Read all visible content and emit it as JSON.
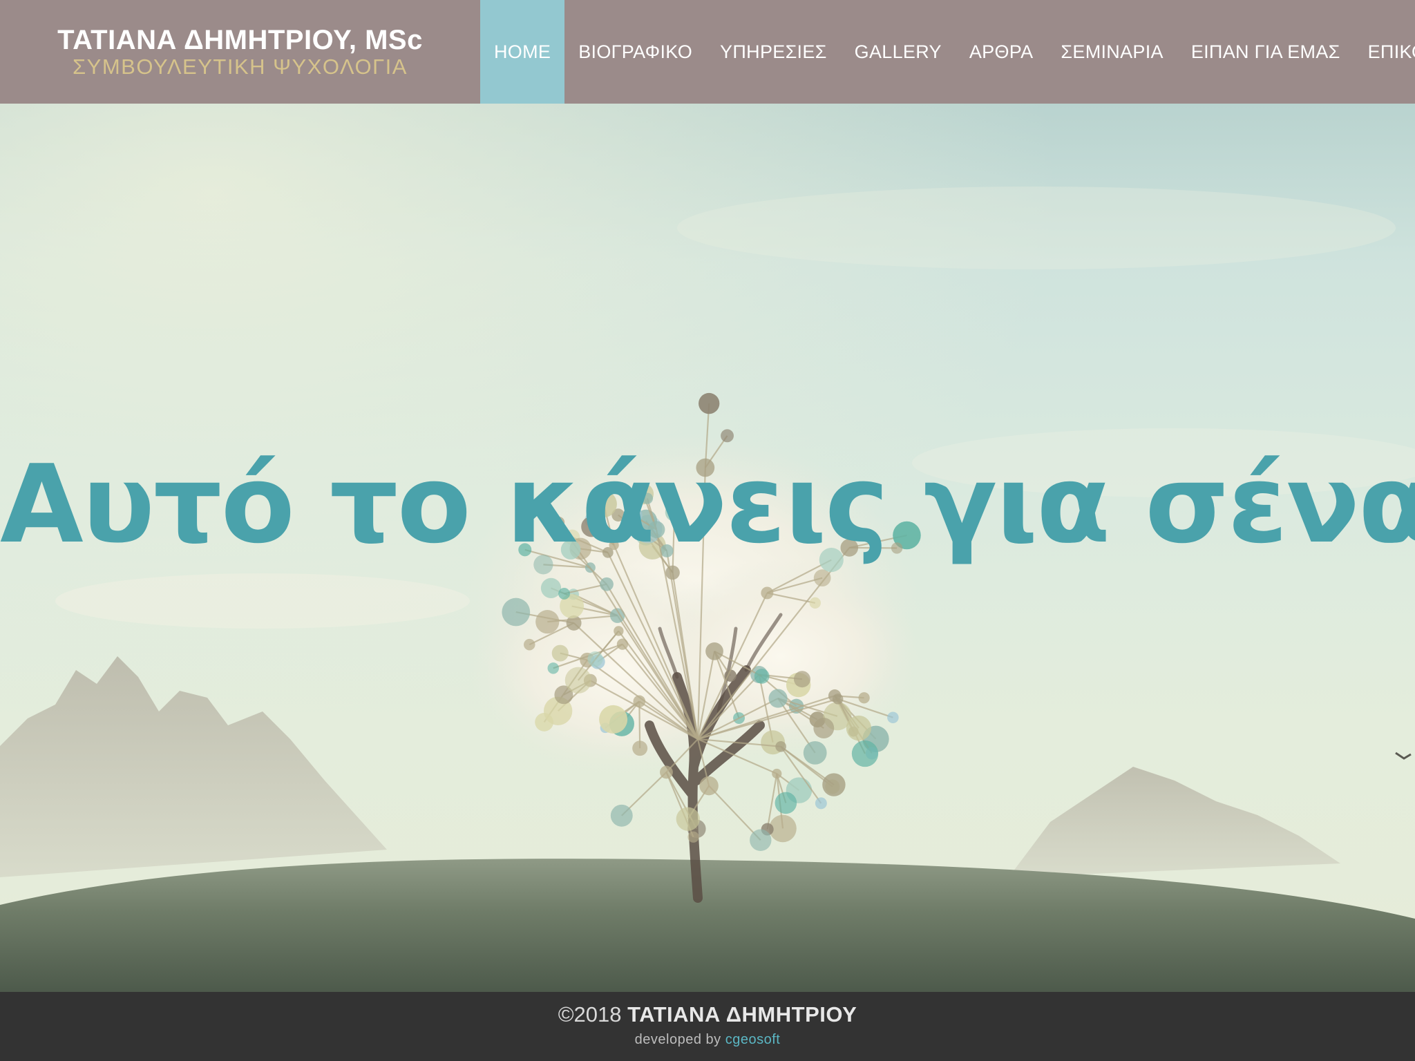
{
  "header": {
    "brand_name": "ΤΑΤΙΑΝΑ ΔΗΜΗΤΡΙΟΥ, MSc",
    "brand_subtitle": "ΣΥΜΒΟΥΛΕΥΤΙΚΗ ΨΥΧΟΛΟΓΙΑ",
    "nav": [
      {
        "label": "HOME",
        "active": true
      },
      {
        "label": "ΒΙΟΓΡΑΦΙΚΟ"
      },
      {
        "label": "ΥΠΗΡΕΣΙΕΣ"
      },
      {
        "label": "GALLERY"
      },
      {
        "label": "ΑΡΘΡΑ"
      },
      {
        "label": "ΣΕΜΙΝΑΡΙΑ"
      },
      {
        "label": "ΕΙΠΑΝ ΓΙΑ ΕΜΑΣ"
      },
      {
        "label": "ΕΠΙΚΟΙΝΩΝΙΑ"
      }
    ]
  },
  "hero": {
    "title": "Αυτό το κάνεις για σένα"
  },
  "footer": {
    "copyright": "©2018",
    "owner": "ΤΑΤΙΑΝΑ ΔΗΜΗΤΡΙΟΥ",
    "developed_by": "developed by",
    "developer": "cgeosoft"
  },
  "colors": {
    "header_bg": "#9b8b8a",
    "nav_active_bg": "#93c8d0",
    "brand_subtitle": "#d6c38b",
    "hero_title": "#4aa2ab",
    "footer_bg": "#333333",
    "footer_link": "#5bb7c4"
  }
}
